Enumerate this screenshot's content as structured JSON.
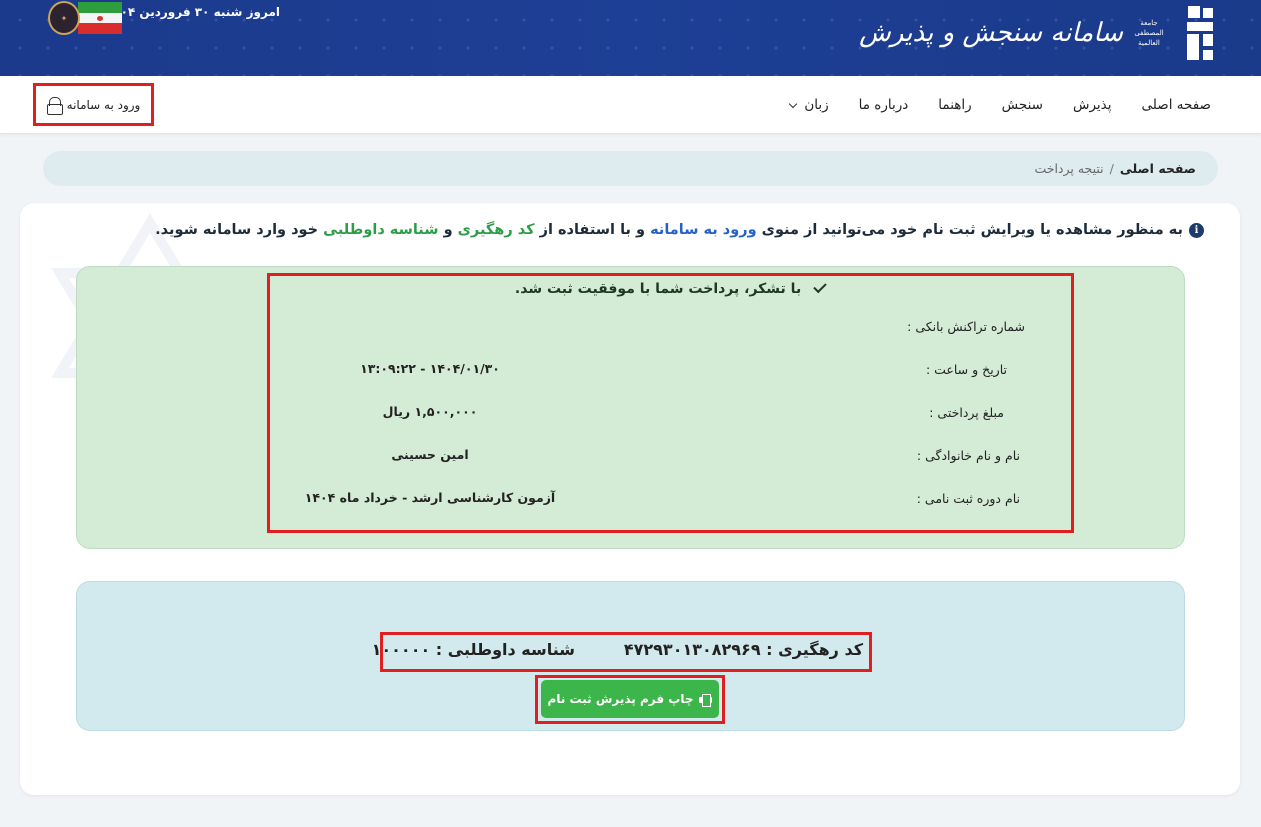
{
  "header": {
    "site_title": "سامانه سنجش و پذیرش",
    "org_lines": [
      "جامعة",
      "المصطفى",
      "العالمية"
    ],
    "date_text": "امروز شنبه ۳۰ فروردین ۱۴۰۴"
  },
  "nav": {
    "items": [
      {
        "label": "صفحه اصلی"
      },
      {
        "label": "پذیرش"
      },
      {
        "label": "سنجش"
      },
      {
        "label": "راهنما"
      },
      {
        "label": "درباره ما"
      },
      {
        "label": "زبان"
      }
    ],
    "login_label": "ورود به سامانه"
  },
  "breadcrumb": {
    "home": "صفحه اصلی",
    "separator": "/",
    "current": "نتیجه پرداخت"
  },
  "payment": {
    "success_message": "با تشکر، پرداخت شما با موفقیت ثبت شد.",
    "rows": [
      {
        "label": "شماره تراکنش بانکی :",
        "value": ""
      },
      {
        "label": "تاریخ و ساعت :",
        "value": "۱۴۰۴/۰۱/۳۰ - ۱۳:۰۹:۲۲"
      },
      {
        "label": "مبلغ پرداختی :",
        "value": "۱,۵۰۰,۰۰۰ ریال"
      },
      {
        "label": "نام و نام خانوادگی :",
        "value": "امین حسینی"
      },
      {
        "label": "نام دوره ثبت نامی :",
        "value": "آزمون کارشناسی ارشد - خرداد ماه ۱۴۰۴"
      }
    ]
  },
  "info": {
    "part1": "به منظور مشاهده یا ویرایش ثبت نام خود می‌توانید از منوی",
    "link_login": "ورود به سامانه",
    "part2": "و با استفاده از",
    "link_tracking": "کد رهگیری",
    "part3": "و",
    "link_applicant": "شناسه داوطلبی",
    "part4": "خود وارد سامانه شوید.",
    "tracking_code": "کد رهگیری : ۴۷۲۹۳۰۱۳۰۸۲۹۶۹",
    "applicant_id": "شناسه داوطلبی : ۱۰۰۰۰۰",
    "print_label": "چاپ فرم پذیرش ثبت نام"
  },
  "colors": {
    "header_bg": "#1d3f95",
    "success_bg": "#d4ebd6",
    "info_bg": "#d2eaee",
    "print_btn": "#3cb54a",
    "highlight": "#e02020",
    "link_blue": "#2563c9",
    "link_green": "#2e9d4a"
  }
}
